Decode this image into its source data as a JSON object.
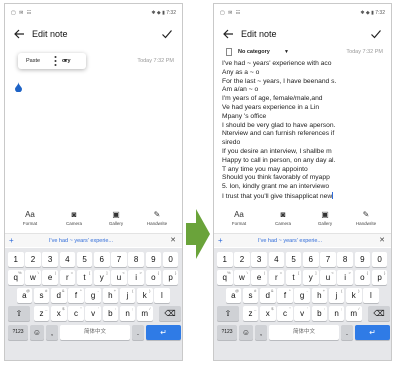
{
  "colors": {
    "accent": "#2f7be6",
    "arrow": "#6aa33a",
    "keyboard_bg": "#e6e7ea"
  },
  "status_left": "▢ ✉ ☷",
  "status_right": "✱ ◆ ▮ 7:32",
  "before": {
    "title": "Edit note",
    "popup": {
      "paste": "Paste",
      "partial": "ory",
      "date": "Today 7:32 PM"
    }
  },
  "after": {
    "title": "Edit note",
    "category": "No category",
    "date": "Today 7:32 PM",
    "lines": [
      "I've had ~ years' experience with aco",
      "Any as a ~ o",
      "For the last ~ years, I have beenand s.",
      "Am a/an ~ o",
      "I'm years of age, female/male,and",
      "Ve had years experience in a Lin",
      "Mpany 's office",
      "I should be very glad to have aperson.",
      "Nterview and can furnish references if",
      "siredo",
      "If you desire an interview, I shallbe m",
      "Happy to call in person, on any day al.",
      "T any time you may appointo",
      "Should you think favorably of myapp",
      "5. Ion, kindly grant me an interviewo",
      "I trust that you'll give thisapplicat new"
    ]
  },
  "toolbar": [
    "Format",
    "Camera",
    "Gallery",
    "Handwrite"
  ],
  "toolbar_icons": [
    "format-icon",
    "camera-icon",
    "gallery-icon",
    "handwrite-icon"
  ],
  "suggestion": "I've had ~ years' experie...",
  "keyboard": {
    "numbers": [
      "1",
      "2",
      "3",
      "4",
      "5",
      "6",
      "7",
      "8",
      "9",
      "0"
    ],
    "row1": [
      "q",
      "w",
      "e",
      "r",
      "t",
      "y",
      "u",
      "i",
      "o",
      "p"
    ],
    "row1_sup": [
      "%",
      "\\",
      "|",
      "=",
      "[",
      "]",
      "<",
      ">",
      "{",
      "}"
    ],
    "row2": [
      "a",
      "s",
      "d",
      "f",
      "g",
      "h",
      "j",
      "k",
      "l"
    ],
    "row2_sup": [
      "@",
      "#",
      "&",
      "*",
      "-",
      "+",
      "(",
      ")",
      ""
    ],
    "row3": [
      "z",
      "x",
      "c",
      "v",
      "b",
      "n",
      "m"
    ],
    "row3_sup": [
      "_",
      "$",
      "\"",
      "'",
      ":",
      ";",
      "/"
    ],
    "bottom": {
      "num": "?123",
      "space": "简体中文",
      "comma": ",",
      "period": "."
    }
  }
}
